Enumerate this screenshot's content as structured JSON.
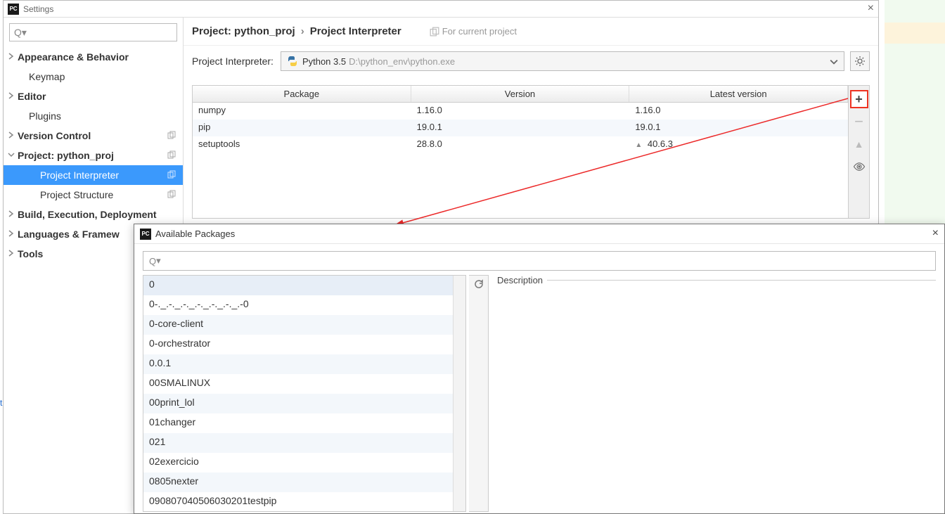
{
  "settings": {
    "window_title": "Settings",
    "close_glyph": "×",
    "search_placeholder": "",
    "tree": {
      "appearance": "Appearance & Behavior",
      "keymap": "Keymap",
      "editor": "Editor",
      "plugins": "Plugins",
      "version_control": "Version Control",
      "project": "Project: python_proj",
      "project_interpreter": "Project Interpreter",
      "project_structure": "Project Structure",
      "build": "Build, Execution, Deployment",
      "languages": "Languages & Framew",
      "tools": "Tools"
    },
    "breadcrumb": {
      "main": "Project: python_proj",
      "sep": "›",
      "leaf": "Project Interpreter",
      "for_current": "For current project"
    },
    "interpreter": {
      "label": "Project Interpreter:",
      "name": "Python 3.5",
      "path": "D:\\python_env\\python.exe"
    },
    "packages": {
      "columns": {
        "pkg": "Package",
        "ver": "Version",
        "latest": "Latest version"
      },
      "rows": [
        {
          "name": "numpy",
          "version": "1.16.0",
          "latest": "1.16.0",
          "upgrade": false
        },
        {
          "name": "pip",
          "version": "19.0.1",
          "latest": "19.0.1",
          "upgrade": false
        },
        {
          "name": "setuptools",
          "version": "28.8.0",
          "latest": "40.6.3",
          "upgrade": true
        }
      ]
    }
  },
  "avail": {
    "window_title": "Available Packages",
    "close_glyph": "×",
    "description_label": "Description",
    "items": [
      "0",
      "0-._.-._.-._.-._.-._.-._.-0",
      "0-core-client",
      "0-orchestrator",
      "0.0.1",
      "00SMALINUX",
      "00print_lol",
      "01changer",
      "021",
      "02exercicio",
      "0805nexter",
      "090807040506030201testpip"
    ]
  },
  "icons": {
    "search": "🔍",
    "chev_down": "▾"
  }
}
